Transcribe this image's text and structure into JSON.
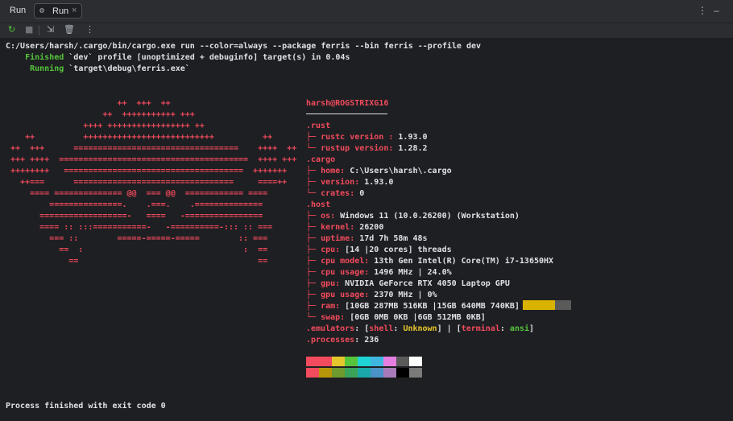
{
  "tool_window": {
    "title": "Run",
    "tab_label": "Run",
    "tab_icon": "rust-crab-icon"
  },
  "console": {
    "command": "C:/Users/harsh/.cargo/bin/cargo.exe run --color=always --package ferris --bin ferris --profile dev",
    "finished_status": "Finished",
    "finished_rest": " `dev` profile [unoptimized + debuginfo] target(s) in 0.04s",
    "running_status": "Running",
    "running_rest": " `target\\debug\\ferris.exe`",
    "exit_message": "Process finished with exit code 0"
  },
  "logo_lines": [
    "                       ++  +++  ++",
    "                    ++  +++++++++++ +++",
    "                ++++ +++++++++++++++++ ++",
    "    ++          +++++++++++++++++++++++++++          ++",
    " ++  +++      ==================================    ++++  ++",
    " +++ ++++  =======================================  ++++ +++",
    " ++++++++   =====================================  +++++++",
    "   ++===      =================================     ====++",
    "     ==== ============== @@  === @@  ============ ====",
    "         ===============.    .===.    .==============",
    "       ==================-   ====   -================",
    "       ==== :: :::===========-   -==========-::: :: ===",
    "         === ::        =====-=====-=====        :: ===",
    "           ==  :                                 :  ==",
    "             ==                                     =="
  ],
  "info": {
    "user": "harsh",
    "at": "@",
    "host": "ROGSTRIXG16",
    "rust_header": ".rust",
    "rustc_label": "rustc version",
    "rustc_value": "1.93.0",
    "rustup_label": "rustup version",
    "rustup_value": "1.28.2",
    "cargo_header": ".cargo",
    "home_label": "home",
    "home_value": "C:\\Users\\harsh\\.cargo",
    "version_label": "version",
    "version_value": "1.93.0",
    "crates_label": "crates",
    "crates_value": "0",
    "host_header": ".host",
    "os_label": "os",
    "os_value": "Windows 11 (10.0.26200) (Workstation)",
    "kernel_label": "kernel",
    "kernel_value": "26200",
    "uptime_label": "uptime",
    "uptime_value": "17d 7h 58m 48s",
    "cpu_label": "cpu",
    "cpu_value": "[14 |20 cores] threads",
    "cpu_model_label": "cpu model",
    "cpu_model_value": "13th Gen Intel(R) Core(TM) i7-13650HX",
    "cpu_usage_label": "cpu usage",
    "cpu_usage_value": "1496 MHz | 24.0%",
    "gpu_label": "gpu",
    "gpu_value": "NVIDIA GeForce RTX 4050 Laptop GPU",
    "gpu_usage_label": "gpu usage",
    "gpu_usage_value": "2370 MHz | 0%",
    "ram_label": "ram",
    "ram_value": "[10GB 287MB 516KB |15GB 640MB 740KB]",
    "ram_fraction": 0.66,
    "swap_label": "swap",
    "swap_value": "[0GB 0MB 0KB |6GB 512MB 0KB]",
    "emulators_label": ".emulators",
    "shell_label": "shell",
    "shell_value": "Unknown",
    "terminal_label": "terminal",
    "terminal_value": "ansi",
    "processes_label": ".processes",
    "processes_value": "236"
  },
  "palette_colors": {
    "row1": [
      "#f24b5d",
      "#f24b5d",
      "#e5c62c",
      "#56c43d",
      "#1fd4d4",
      "#3fb6e0",
      "#e57ee0",
      "#5a5a5a",
      "#ffffff"
    ],
    "row2": [
      "#f24b5d",
      "#b8960a",
      "#6e9a2e",
      "#3aa35a",
      "#1aa8a8",
      "#4a92c8",
      "#a87ab8",
      "#000000",
      "#7a7a7a"
    ]
  }
}
